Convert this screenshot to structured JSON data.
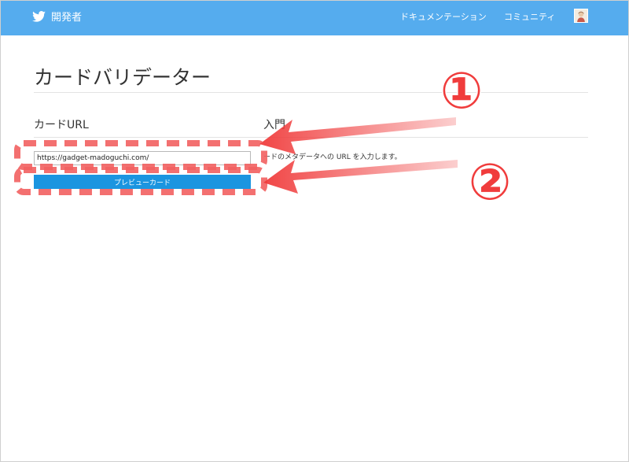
{
  "navbar": {
    "brand": "開発者",
    "links": [
      "ドキュメンテーション",
      "コミュニティ"
    ],
    "icons": [
      "twitter-bird-icon",
      "user-avatar"
    ],
    "background": "#55acee"
  },
  "page": {
    "title": "カードバリデーター"
  },
  "left_column": {
    "heading": "カードURL",
    "url_input_value": "https://gadget-madoguchi.com/",
    "preview_button_label": "プレビューカード",
    "button_color": "#1b95e0"
  },
  "right_column": {
    "heading": "入門",
    "intro_text": "ードのメタデータへの URL を入力します。"
  },
  "annotations": {
    "callout_1": "①",
    "callout_2": "②",
    "color": "#f03c3c"
  }
}
